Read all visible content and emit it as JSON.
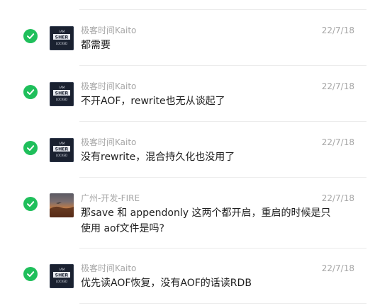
{
  "colors": {
    "check": "#1fbf5b",
    "meta_text": "#a6a6a6",
    "body_text": "#1f1f1f",
    "divider": "#ececec"
  },
  "avatars": {
    "kaito_lines": [
      "I AM",
      "SHER",
      "LOCKED"
    ]
  },
  "messages": [
    {
      "icon": "check-circle-icon",
      "avatar": "sherlock-avatar",
      "name": "极客时间Kaito",
      "date": "22/7/18",
      "lines": [
        "都需要"
      ]
    },
    {
      "icon": "check-circle-icon",
      "avatar": "sherlock-avatar",
      "name": "极客时间Kaito",
      "date": "22/7/18",
      "lines": [
        "不开AOF，rewrite也无从谈起了"
      ]
    },
    {
      "icon": "check-circle-icon",
      "avatar": "sherlock-avatar",
      "name": "极客时间Kaito",
      "date": "22/7/18",
      "lines": [
        "没有rewrite，混合持久化也没用了"
      ]
    },
    {
      "icon": "check-circle-icon",
      "avatar": "sunset-avatar",
      "name": "广州-开发-FIRE",
      "date": "22/7/18",
      "lines": [
        "那save 和 appendonly 这两个都开启，重启的时候是只",
        "使用 aof文件是吗?"
      ]
    },
    {
      "icon": "check-circle-icon",
      "avatar": "sherlock-avatar",
      "name": "极客时间Kaito",
      "date": "22/7/18",
      "lines": [
        "优先读AOF恢复，没有AOF的话读RDB"
      ]
    }
  ]
}
